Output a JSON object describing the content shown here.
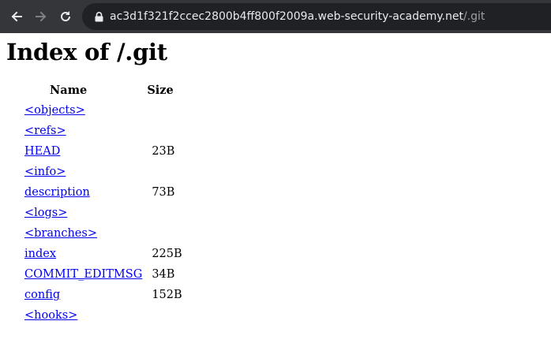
{
  "browser": {
    "url_host": "ac3d1f321f2ccec2800b4ff800f2009a.web-security-academy.net",
    "url_path": "/.git",
    "icons": {
      "back": "arrow-left-icon",
      "forward": "arrow-right-icon",
      "reload": "reload-icon",
      "lock": "lock-icon"
    }
  },
  "page": {
    "title": "Index of /.git",
    "columns": {
      "name": "Name",
      "size": "Size"
    },
    "rows": [
      {
        "name": "<objects>",
        "size": ""
      },
      {
        "name": "<refs>",
        "size": ""
      },
      {
        "name": "HEAD",
        "size": "23B"
      },
      {
        "name": "<info>",
        "size": ""
      },
      {
        "name": "description",
        "size": "73B"
      },
      {
        "name": "<logs>",
        "size": ""
      },
      {
        "name": "<branches>",
        "size": ""
      },
      {
        "name": "index",
        "size": "225B"
      },
      {
        "name": "COMMIT_EDITMSG",
        "size": "34B"
      },
      {
        "name": "config",
        "size": "152B"
      },
      {
        "name": "<hooks>",
        "size": ""
      }
    ]
  },
  "colors": {
    "toolbar": "#35363a",
    "omnibox": "#202124",
    "link": "#0000ee"
  }
}
